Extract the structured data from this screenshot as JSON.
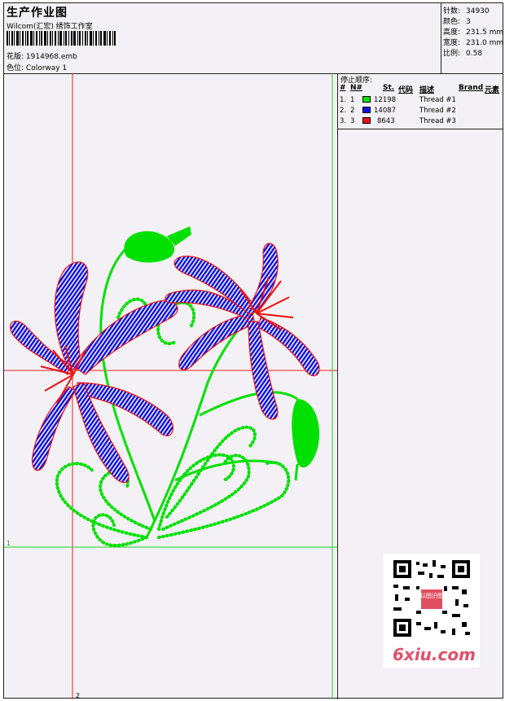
{
  "header": {
    "title": "生产作业图",
    "company": "Wilcom(汇宏) 绣饰工作室",
    "design_label": "花版:",
    "design_file": "1914968.emb",
    "colorway_label": "色位:",
    "colorway": "Colorway 1"
  },
  "stats": [
    {
      "label": "针数:",
      "value": "34930"
    },
    {
      "label": "颜色:",
      "value": "3"
    },
    {
      "label": "高度:",
      "value": "231.5 mm"
    },
    {
      "label": "宽度:",
      "value": "231.0 mm"
    },
    {
      "label": "比例:",
      "value": "0.58"
    }
  ],
  "thread_table": {
    "caption": "停止顺序:",
    "headers": {
      "hash": "#",
      "no": "N#",
      "st": "St.",
      "code": "代码",
      "desc": "描述",
      "brand": "Brand",
      "elem": "元素"
    },
    "rows": [
      {
        "seq": "1.",
        "n": "1",
        "color": "#00e000",
        "stitches": "12198",
        "desc": "Thread #1"
      },
      {
        "seq": "2.",
        "n": "2",
        "color": "#1010e0",
        "stitches": "14087",
        "desc": "Thread #2"
      },
      {
        "seq": "3.",
        "n": "3",
        "color": "#ee1010",
        "stitches": "8643",
        "desc": "Thread #3"
      }
    ]
  },
  "guides": {
    "horizontal_label": "1",
    "vertical_label": "2"
  },
  "colors": {
    "green": "#00e000",
    "blue": "#1010e0",
    "red": "#ee1010"
  },
  "qr": {
    "stamp_text": "以图识图",
    "watermark": "6xiu.com"
  }
}
